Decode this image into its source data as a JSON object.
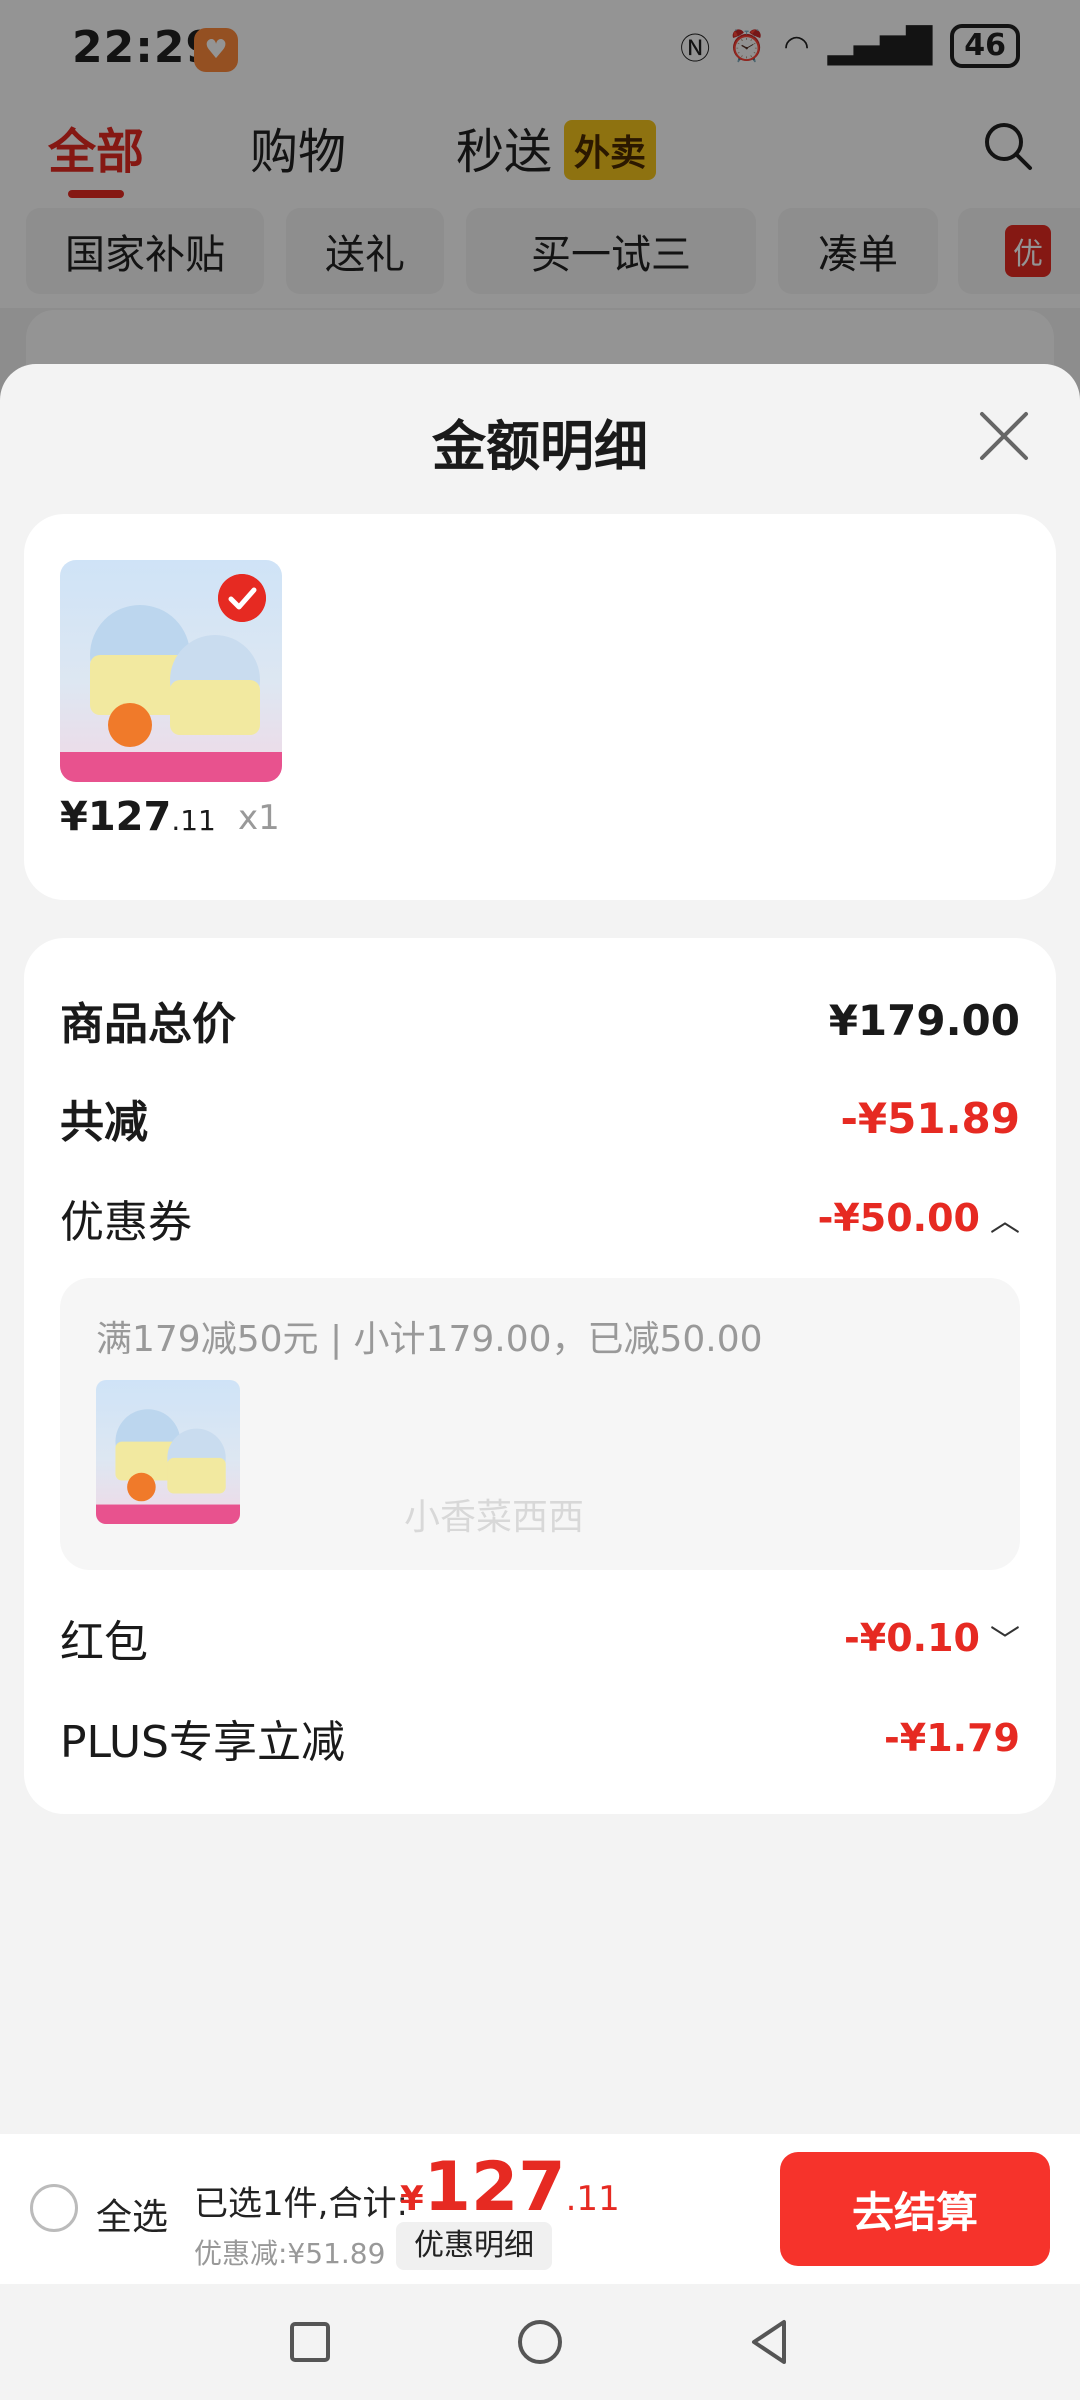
{
  "status_bar": {
    "time": "22:29",
    "battery": "46",
    "network": "5G"
  },
  "tabs": [
    {
      "label": "全部"
    },
    {
      "label": "购物"
    },
    {
      "label": "秒送"
    }
  ],
  "waimai_tag": "外卖",
  "chips": [
    {
      "label": "国家补贴"
    },
    {
      "label": "送礼"
    },
    {
      "label": "买一试三"
    },
    {
      "label": "凑单"
    },
    {
      "label": "优"
    }
  ],
  "sheet": {
    "title": "金额明细",
    "product": {
      "price_int": "¥127",
      "price_dec": ".11",
      "qty": "x1"
    },
    "rows": {
      "total_label": "商品总价",
      "total_value": "¥179.00",
      "reduce_label": "共减",
      "reduce_value": "-¥51.89",
      "coupon_label": "优惠券",
      "coupon_value": "-¥50.00",
      "redpack_label": "红包",
      "redpack_value": "-¥0.10",
      "plus_label": "PLUS专享立减",
      "plus_value": "-¥1.79"
    },
    "coupon_detail": "满179减50元 | 小计179.00，已减50.00",
    "watermark": "小香菜西西"
  },
  "bottom_bar": {
    "select_all": "全选",
    "selected_text": "已选1件,合计:",
    "total_currency": "¥",
    "total_int": "127",
    "total_dec": ".11",
    "saved": "优惠减:¥51.89",
    "detail_button": "优惠明细",
    "checkout_button": "去结算"
  },
  "colors": {
    "accent": "#e62a22",
    "checkout": "#f6332b",
    "waimai": "#f4c51d"
  }
}
